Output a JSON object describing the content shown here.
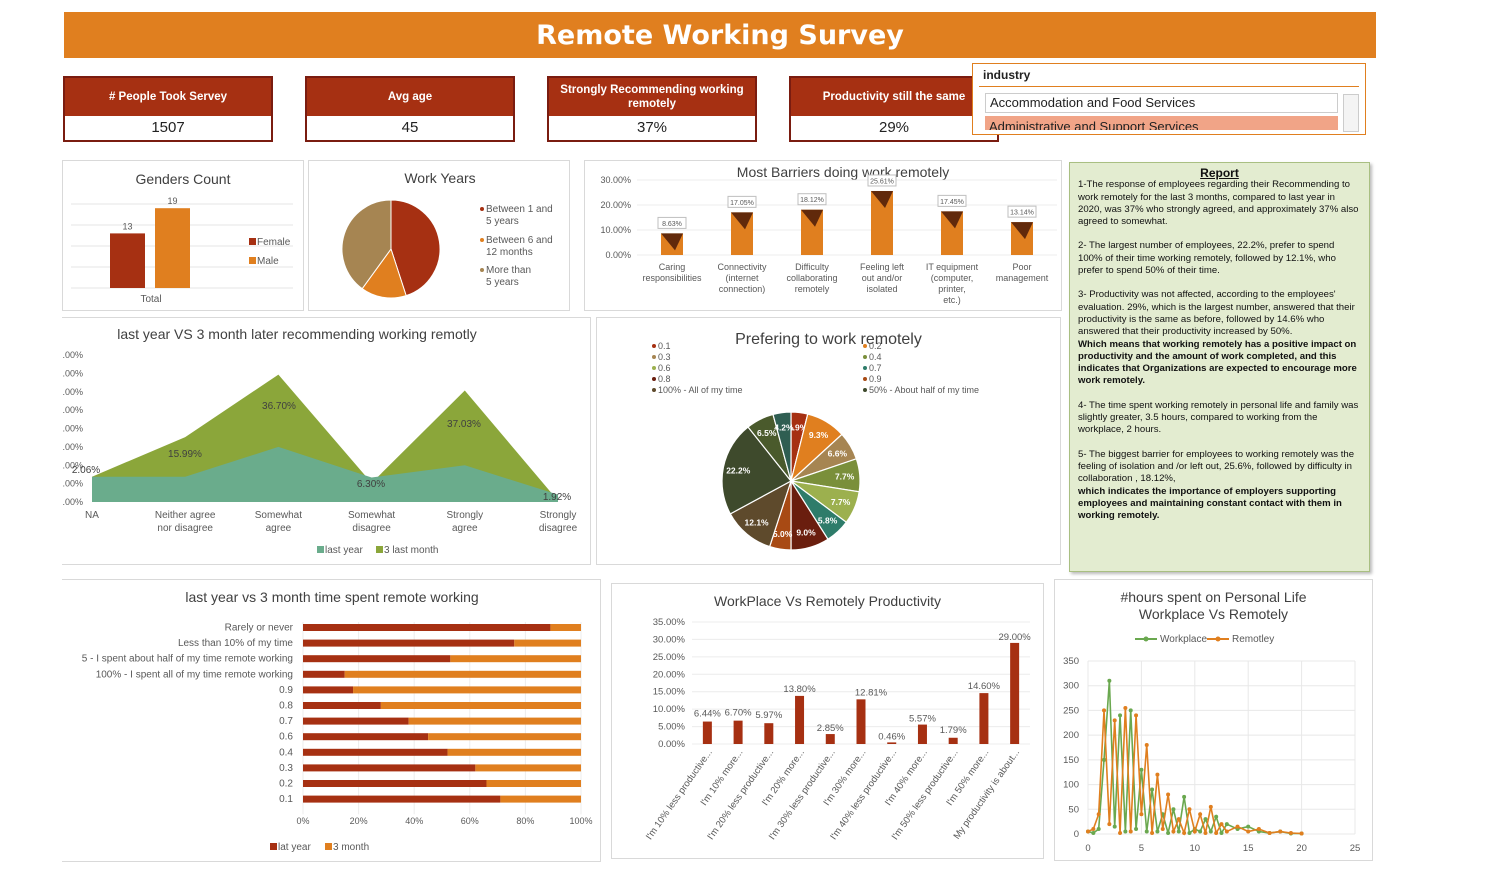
{
  "title": "Remote Working Survey",
  "kpis": [
    {
      "label": "# People Took Servey",
      "value": "1507"
    },
    {
      "label": "Avg age",
      "value": "45"
    },
    {
      "label": "Strongly Recommending working remotely",
      "value": "37%"
    },
    {
      "label": "Productivity still the same",
      "value": "29%"
    }
  ],
  "slicer": {
    "header": "industry",
    "items": [
      "Accommodation and Food Services",
      "Administrative and Support Services"
    ]
  },
  "report": {
    "title": "Report",
    "paragraphs": [
      "1-The response of employees regarding their Recommending to work remotely for the last 3 months, compared to last year in 2020, was 37% who strongly agreed, and approximately 37% also agreed to somewhat.",
      "2- The largest number of employees, 22.2%, prefer to spend 100% of their time working remotely, followed by 12.1%, who prefer to spend 50% of their time.",
      "3- Productivity was not affected, according to the employees' evaluation. 29%, which is the largest number, answered that their productivity is the same as before, followed by 14.6% who answered that their productivity increased by 50%.",
      "Which means that working remotely has a positive impact on productivity and the amount of work completed, and this indicates that Organizations are expected to encourage more work remotely.",
      "4- The time spent working remotely in personal life and family was slightly greater, 3.5 hours, compared to working from the workplace, 2 hours.",
      "5- The biggest barrier for employees to working remotely was the feeling of isolation and /or left out, 25.6%, followed by difficulty in collaboration , 18.12%,",
      "which indicates the importance of employers supporting employees and maintaining constant contact with them in working remotely."
    ]
  },
  "chart_data": [
    {
      "type": "bar",
      "title": "Genders Count",
      "categories": [
        "Total"
      ],
      "series": [
        {
          "name": "Female",
          "values": [
            13
          ]
        },
        {
          "name": "Male",
          "values": [
            19
          ]
        }
      ],
      "colors": [
        "#a63012",
        "#e07f1f"
      ],
      "legend": "right"
    },
    {
      "type": "pie",
      "title": "Work Years",
      "labels": [
        "Between 1 and 5 years",
        "Between 6 and 12 months",
        "More than 5 years"
      ],
      "values": [
        0.45,
        0.15,
        0.4
      ],
      "colors": [
        "#a63012",
        "#e07f1f",
        "#a68552"
      ],
      "legend": "right"
    },
    {
      "type": "bar",
      "title": "Most Barriers doing work remotely",
      "categories": [
        "Caring responsibilities",
        "Connectivity (internet connection)",
        "Difficulty collaborating remotely",
        "Feeling left out and/or isolated",
        "IT equipment (computer, printer, etc.)",
        "Poor management"
      ],
      "values": [
        8.63,
        17.05,
        18.12,
        25.61,
        17.45,
        13.14
      ],
      "data_labels": [
        "8.63%",
        "17.05%",
        "18.12%",
        "25.61%",
        "17.45%",
        "13.14%"
      ],
      "yticks": [
        "30.00%",
        "20.00%",
        "10.00%",
        "0.00%"
      ],
      "ylim": [
        0,
        30
      ]
    },
    {
      "type": "area",
      "title": "last year VS 3 month later recommending working remotly",
      "categories": [
        "NA",
        "Neither agree nor disagree",
        "Somewhat agree",
        "Somewhat disagree",
        "Strongly agree",
        "Strongly disagree"
      ],
      "series": [
        {
          "name": "last year",
          "values": [
            2.06,
            2.06,
            4.5,
            2.0,
            3.0,
            0.6
          ]
        },
        {
          "name": "3 last month",
          "values": [
            2.06,
            5.3,
            10.4,
            1.55,
            9.1,
            0.1
          ]
        }
      ],
      "data_labels": [
        "2.06%",
        "15.99%",
        "36.70%",
        "6.30%",
        "37.03%",
        "1.92%"
      ],
      "yticks": [
        ".00%",
        ".00%",
        ".00%",
        ".00%",
        ".00%",
        ".00%",
        ".00%",
        ".00%",
        ".00%"
      ],
      "ylim": [
        0,
        12
      ],
      "colors": [
        "#6aac8c",
        "#8ba63a"
      ],
      "legend": "bottom"
    },
    {
      "type": "pie",
      "title": "Prefering to work remotely",
      "legend_labels": [
        "0.1",
        "0.2",
        "0.3",
        "0.4",
        "0.6",
        "0.7",
        "0.8",
        "0.9",
        "100% - All of my time",
        "50% - About half of my time"
      ],
      "slices": [
        {
          "value": 3.9,
          "label": "3.9%",
          "color": "#a63012"
        },
        {
          "value": 9.3,
          "label": "9.3%",
          "color": "#e07f1f"
        },
        {
          "value": 6.6,
          "label": "6.6%",
          "color": "#a68552"
        },
        {
          "value": 7.7,
          "label": "7.7%",
          "color": "#7a8f3a"
        },
        {
          "value": 7.7,
          "label": "7.7%",
          "color": "#9cb04e"
        },
        {
          "value": 5.8,
          "label": "5.8%",
          "color": "#2e7c6a"
        },
        {
          "value": 9.0,
          "label": "9.0%",
          "color": "#6a1e0e"
        },
        {
          "value": 5.0,
          "label": "5.0%",
          "color": "#a84a14"
        },
        {
          "value": 12.1,
          "label": "12.1%",
          "color": "#5e4a2c"
        },
        {
          "value": 22.2,
          "label": "22.2%",
          "color": "#3e4a2c"
        },
        {
          "value": 6.5,
          "label": "6.5%",
          "color": "#4a5a2c"
        },
        {
          "value": 4.2,
          "label": "4.2%",
          "color": "#2f5e52"
        }
      ]
    },
    {
      "type": "bar",
      "title": "last year vs 3 month time spent remote working",
      "orientation": "horizontal",
      "stacked": "percent",
      "categories": [
        "Rarely or never",
        "Less than 10% of my time",
        "5 - I spent about half of my time remote working",
        "100% - I spent all of my time remote working",
        "0.9",
        "0.8",
        "0.7",
        "0.6",
        "0.4",
        "0.3",
        "0.2",
        "0.1"
      ],
      "series": [
        {
          "name": "lat year",
          "values": [
            89,
            76,
            53,
            15,
            18,
            28,
            38,
            45,
            52,
            62,
            66,
            71
          ]
        },
        {
          "name": "3 month",
          "values": [
            11,
            24,
            47,
            85,
            82,
            72,
            62,
            55,
            48,
            38,
            34,
            29
          ]
        }
      ],
      "xticks": [
        "0%",
        "20%",
        "40%",
        "60%",
        "80%",
        "100%"
      ],
      "colors": [
        "#a63012",
        "#e07f1f"
      ],
      "legend": "bottom"
    },
    {
      "type": "bar",
      "title": "WorkPlace Vs Remotely Productivity",
      "categories": [
        "I'm 10% less productive...",
        "I'm 10% more...",
        "I'm 20% less productive...",
        "I'm 20% more...",
        "I'm 30% less productive...",
        "I'm 30% more...",
        "I'm 40% less productive...",
        "I'm 40% more...",
        "I'm 50% less productive...",
        "I'm 50% more...",
        "My productivity is about..."
      ],
      "values": [
        6.44,
        6.7,
        5.97,
        13.8,
        2.85,
        12.81,
        0.46,
        5.57,
        1.79,
        14.6,
        29.0
      ],
      "data_labels": [
        "6.44%",
        "6.70%",
        "5.97%",
        "13.80%",
        "2.85%",
        "12.81%",
        "0.46%",
        "5.57%",
        "1.79%",
        "14.60%",
        "29.00%"
      ],
      "yticks": [
        "35.00%",
        "30.00%",
        "25.00%",
        "20.00%",
        "15.00%",
        "10.00%",
        "5.00%",
        "0.00%"
      ],
      "ylim": [
        0,
        35
      ],
      "colors": [
        "#a63012"
      ]
    },
    {
      "type": "line",
      "title": "#hours spent on Personal Life Workplace Vs Remotely",
      "x": [
        0,
        0.5,
        1,
        1.5,
        2,
        2.5,
        3,
        3.5,
        4,
        4.5,
        5,
        5.5,
        6,
        6.5,
        7,
        7.5,
        8,
        8.5,
        9,
        9.5,
        10,
        10.5,
        11,
        11.5,
        12,
        12.5,
        13,
        14,
        15,
        16,
        17,
        18,
        19,
        20
      ],
      "series": [
        {
          "name": "Workplace",
          "values": [
            5,
            2,
            10,
            150,
            310,
            15,
            240,
            5,
            250,
            10,
            130,
            5,
            90,
            5,
            40,
            2,
            50,
            5,
            75,
            2,
            10,
            5,
            30,
            5,
            35,
            2,
            20,
            10,
            15,
            5,
            2,
            5,
            1,
            1
          ]
        },
        {
          "name": "Remotley",
          "values": [
            5,
            10,
            40,
            250,
            20,
            230,
            2,
            255,
            5,
            240,
            40,
            180,
            2,
            120,
            10,
            80,
            5,
            30,
            2,
            50,
            5,
            40,
            2,
            55,
            2,
            20,
            5,
            15,
            5,
            10,
            2,
            5,
            2,
            1
          ]
        }
      ],
      "yticks": [
        350,
        300,
        250,
        200,
        150,
        100,
        50,
        0
      ],
      "xticks": [
        0,
        5,
        10,
        15,
        20,
        25
      ],
      "ylim": [
        0,
        350
      ],
      "xlim": [
        0,
        25
      ],
      "colors": [
        "#6aa84f",
        "#e07f1f"
      ],
      "legend": "top"
    }
  ]
}
